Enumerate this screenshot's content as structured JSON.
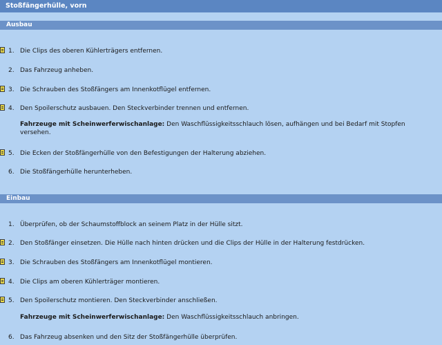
{
  "title": "Stoßfängerhülle, vorn",
  "ausbau": {
    "header": "Ausbau",
    "steps": [
      {
        "num": "1.",
        "text": "Die Clips des oberen Kühlerträgers entfernen.",
        "icon": "document-icon"
      },
      {
        "num": "2.",
        "text": "Das Fahrzeug anheben."
      },
      {
        "num": "3.",
        "text": "Die Schrauben des Stoßfängers am Innenkotflügel entfernen.",
        "icon": "document-icon"
      },
      {
        "num": "4.",
        "text": "Den Spoilerschutz ausbauen. Den Steckverbinder trennen und entfernen.",
        "icon": "document-icon"
      },
      {
        "num": "5.",
        "text": "Die Ecken der Stoßfängerhülle von den Befestigungen der Halterung abziehen.",
        "icon": "document-icon"
      },
      {
        "num": "6.",
        "text": "Die Stoßfängerhülle herunterheben."
      }
    ],
    "note": {
      "label": "Fahrzeuge mit Scheinwerferwischanlage:",
      "text": " Den Waschflüssigkeitsschlauch lösen, aufhängen und bei Bedarf mit Stopfen versehen."
    }
  },
  "einbau": {
    "header": "Einbau",
    "steps": [
      {
        "num": "1.",
        "text": "Überprüfen, ob der Schaumstoffblock an seinem Platz in der Hülle sitzt."
      },
      {
        "num": "2.",
        "text": "Den Stoßfänger einsetzen. Die Hülle nach hinten drücken und die Clips der Hülle in der Halterung festdrücken.",
        "icon": "document-icon"
      },
      {
        "num": "3.",
        "text": "Die Schrauben des Stoßfängers am Innenkotflügel montieren.",
        "icon": "document-icon"
      },
      {
        "num": "4.",
        "text": "Die Clips am oberen Kühlerträger montieren.",
        "icon": "document-icon"
      },
      {
        "num": "5.",
        "text": "Den Spoilerschutz montieren. Den Steckverbinder anschließen.",
        "icon": "document-icon"
      },
      {
        "num": "6.",
        "text": "Das Fahrzeug absenken und den Sitz der Stoßfängerhülle überprüfen."
      }
    ],
    "note": {
      "label": "Fahrzeuge mit Scheinwerferwischanlage:",
      "text": " Den Waschflüssigkeitsschlauch anbringen."
    }
  }
}
